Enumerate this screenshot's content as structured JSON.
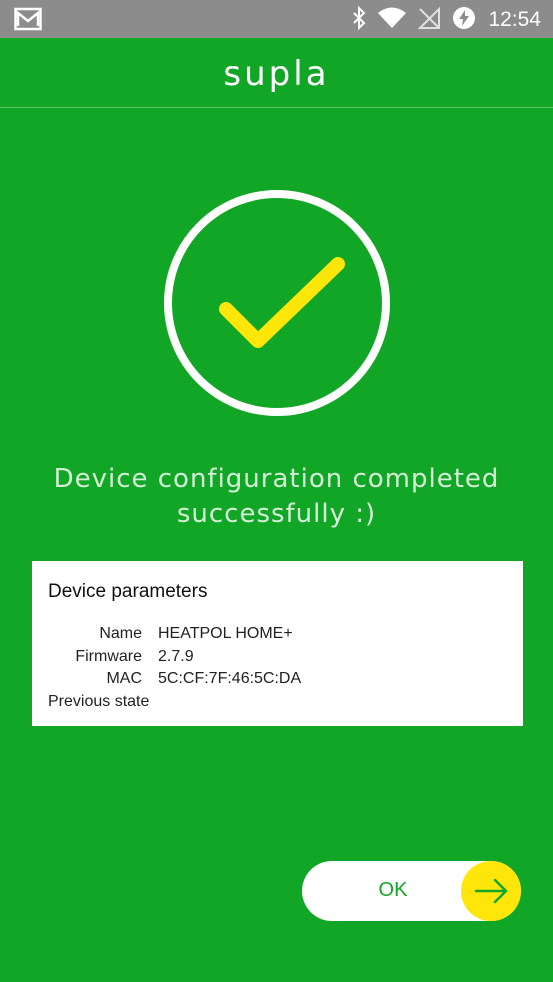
{
  "status_bar": {
    "time": "12:54",
    "icons": [
      "gmail-icon",
      "bluetooth-icon",
      "wifi-icon",
      "no-sim-icon",
      "battery-saver-icon"
    ]
  },
  "header": {
    "logo": "supla"
  },
  "success": {
    "icon": "checkmark-icon",
    "message_line1": "Device configuration completed",
    "message_line2": "successfully :)"
  },
  "device_parameters": {
    "title": "Device parameters",
    "rows": [
      {
        "label": "Name",
        "value": "HEATPOL HOME+"
      },
      {
        "label": "Firmware",
        "value": "2.7.9"
      },
      {
        "label": "MAC",
        "value": "5C:CF:7F:46:5C:DA"
      },
      {
        "label": "Previous state",
        "value": ""
      }
    ]
  },
  "ok_button": {
    "label": "OK",
    "icon": "arrow-right-icon"
  },
  "colors": {
    "background": "#12a626",
    "accent": "#ffe60a",
    "status_bar": "#8c8c8c"
  }
}
